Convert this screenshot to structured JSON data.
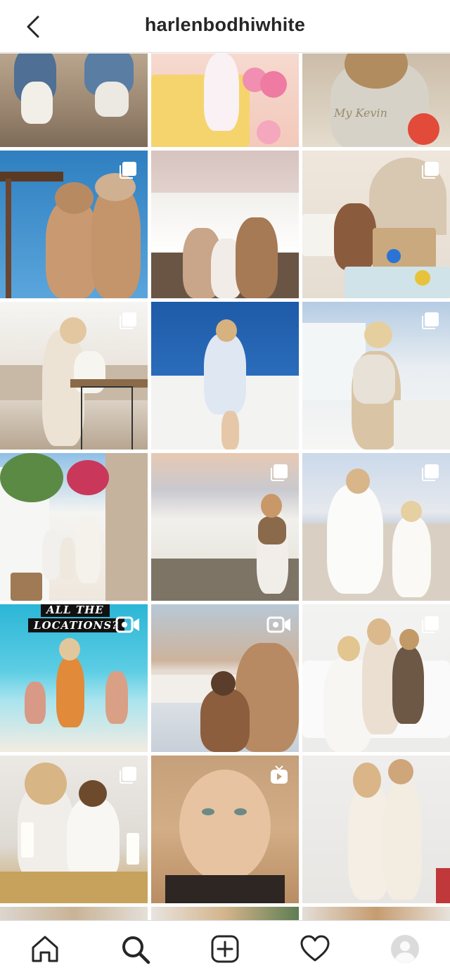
{
  "header": {
    "username": "harlenbodhiwhite"
  },
  "grid": {
    "rows": [
      {
        "tiles": [
          {
            "badge": "none"
          },
          {
            "badge": "none"
          },
          {
            "badge": "none"
          }
        ]
      },
      {
        "tiles": [
          {
            "badge": "multi"
          },
          {
            "badge": "none"
          },
          {
            "badge": "multi"
          }
        ]
      },
      {
        "tiles": [
          {
            "badge": "multi"
          },
          {
            "badge": "none"
          },
          {
            "badge": "multi"
          }
        ]
      },
      {
        "tiles": [
          {
            "badge": "none"
          },
          {
            "badge": "multi"
          },
          {
            "badge": "multi"
          }
        ]
      },
      {
        "tiles": [
          {
            "badge": "video",
            "overlay_lines": [
              "ALL THE",
              "LOCATIONS?"
            ]
          },
          {
            "badge": "video"
          },
          {
            "badge": "multi"
          }
        ]
      },
      {
        "tiles": [
          {
            "badge": "multi"
          },
          {
            "badge": "igtv"
          },
          {
            "badge": "none"
          }
        ]
      }
    ],
    "watermark": "My Kevin"
  },
  "tabbar": {
    "icons": [
      "home-icon",
      "search-icon",
      "new-post-icon",
      "activity-heart-icon",
      "profile-avatar-icon"
    ],
    "active": "search-icon"
  }
}
